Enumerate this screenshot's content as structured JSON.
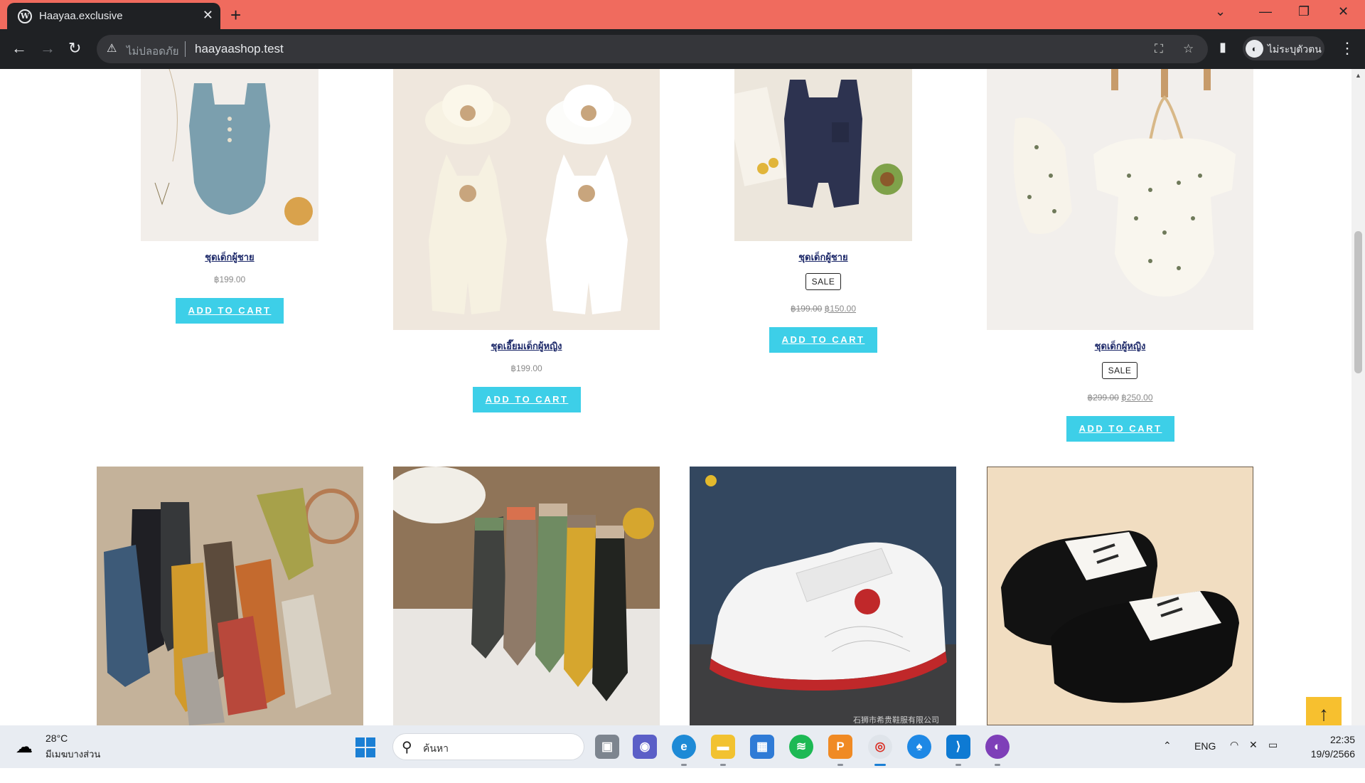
{
  "browser": {
    "tab_title": "Haayaa.exclusive",
    "tab_close": "✕",
    "new_tab": "+",
    "insecure_label": "ไม่ปลอดภัย",
    "url": "haayaashop.test",
    "profile_label": "ไม่ระบุตัวตน",
    "colors": {
      "tabstrip": "#f06b5e",
      "toolbar": "#1f2124"
    }
  },
  "products_row1": [
    {
      "name": "ชุดเด็กผู้ชาย",
      "price": "฿199.00",
      "cart_label": "ADD TO CART",
      "image": "blue-romper"
    },
    {
      "name": "ชุดเอี๊ยมเด็กผู้หญิง",
      "price": "฿199.00",
      "cart_label": "ADD TO CART",
      "image": "white-bear-overalls"
    },
    {
      "name": "ชุดเด็กผู้ชาย",
      "sale_badge": "SALE",
      "old_price": "฿199.00",
      "new_price": "฿150.00",
      "cart_label": "ADD TO CART",
      "image": "navy-romper"
    },
    {
      "name": "ชุดเด็กผู้หญิง",
      "sale_badge": "SALE",
      "old_price": "฿299.00",
      "new_price": "฿250.00",
      "cart_label": "ADD TO CART",
      "image": "floral-romper"
    }
  ],
  "products_row2": [
    {
      "image": "colorful-socks"
    },
    {
      "image": "ribbed-socks"
    },
    {
      "image": "spider-sneaker",
      "image_caption": "石狮市希贵鞋服有限公司"
    },
    {
      "image": "black-white-oxfords"
    }
  ],
  "scroll_top_icon": "↑",
  "taskbar": {
    "temperature": "28°C",
    "weather": "มีเมฆบางส่วน",
    "search_placeholder": "ค้นหา",
    "language": "ENG",
    "time": "22:35",
    "date": "19/9/2566"
  }
}
